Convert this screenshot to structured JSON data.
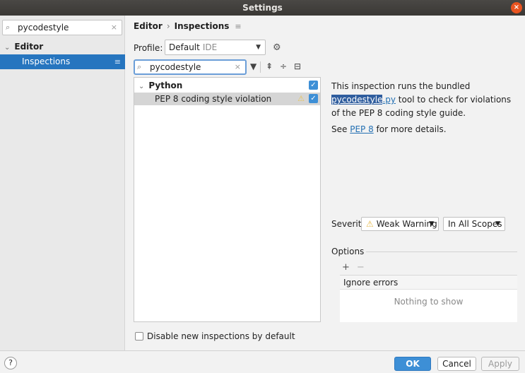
{
  "window": {
    "title": "Settings",
    "close_glyph": "×"
  },
  "sidebar": {
    "search_value": "pycodestyle",
    "tree": [
      {
        "label": "Editor",
        "expanded": true
      },
      {
        "label": "Inspections",
        "selected": true
      }
    ]
  },
  "breadcrumb": {
    "parent": "Editor",
    "current": "Inspections"
  },
  "profile": {
    "label": "Profile:",
    "value": "Default",
    "scope": "IDE"
  },
  "filter": {
    "value": "pycodestyle"
  },
  "inspections_tree": [
    {
      "label": "Python",
      "checked": true
    },
    {
      "label": "PEP 8 coding style violation",
      "checked": true,
      "severity_icon": "warning-icon"
    }
  ],
  "description": {
    "prefix": "This inspection runs the bundled ",
    "link_selected": "pycodestyle",
    "link_rest": ".py",
    "suffix": " tool to check for violations of the PEP 8 coding style guide.",
    "see_prefix": "See ",
    "see_link": "PEP 8",
    "see_suffix": " for more details."
  },
  "severity": {
    "label": "Severity:",
    "value": "Weak Warning",
    "scope": "In All Scopes"
  },
  "options": {
    "label": "Options",
    "add": "+",
    "remove": "−",
    "column_header": "Ignore errors",
    "empty_text": "Nothing to show"
  },
  "disable_new": {
    "label": "Disable new inspections by default",
    "checked": false
  },
  "buttons": {
    "help": "?",
    "ok": "OK",
    "cancel": "Cancel",
    "apply": "Apply"
  },
  "colors": {
    "accent": "#2675bf",
    "ok_button": "#3d8fd6",
    "close": "#e95420",
    "warning": "#e6b84a"
  }
}
